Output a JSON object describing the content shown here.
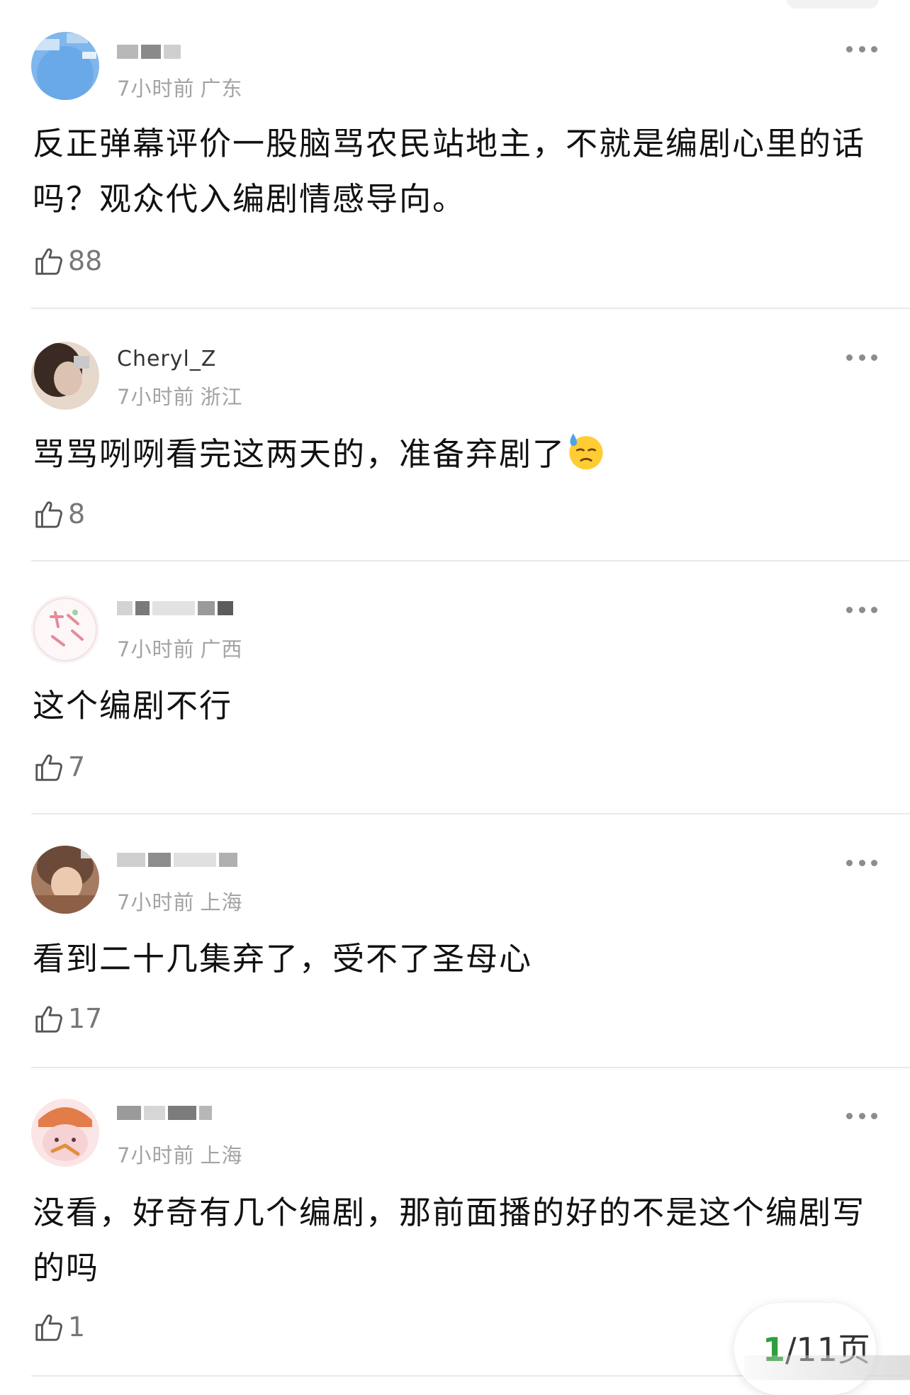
{
  "comments": [
    {
      "username": "酱油",
      "time": "7小时前",
      "location": "广东",
      "text": "反正弹幕评价一股脑骂农民站地主，不就是编剧心里的话吗？观众代入编剧情感导向。",
      "likes": "88",
      "avatar_colors": [
        "#6aa9e8",
        "#9cc9f2"
      ]
    },
    {
      "username": "Cheryl_Z",
      "time": "7小时前",
      "location": "浙江",
      "text": "骂骂咧咧看完这两天的，准备弃剧了",
      "emoji": "downcast-face-with-sweat",
      "likes": "8",
      "avatar_colors": [
        "#3a2a24",
        "#d9c3b5"
      ]
    },
    {
      "username": "",
      "time": "7小时前",
      "location": "广西",
      "text": "这个编剧不行",
      "likes": "7",
      "avatar_colors": [
        "#fbf3f3",
        "#e58a9a"
      ]
    },
    {
      "username": "",
      "time": "7小时前",
      "location": "上海",
      "text": "看到二十几集弃了，受不了圣母心",
      "likes": "17",
      "avatar_colors": [
        "#6b4a3a",
        "#e8c3a9"
      ]
    },
    {
      "username": "",
      "time": "7小时前",
      "location": "上海",
      "text": "没看，好奇有几个编剧，那前面播的好的不是这个编剧写的吗",
      "likes": "1",
      "avatar_colors": [
        "#f7d2d4",
        "#e27d4a"
      ]
    }
  ],
  "page_indicator": {
    "current": "1",
    "total_label": "/11页"
  },
  "colors": {
    "accent_green": "#2f9e3d",
    "meta_gray": "#a3a3a3",
    "divider": "#e9e9e9"
  }
}
